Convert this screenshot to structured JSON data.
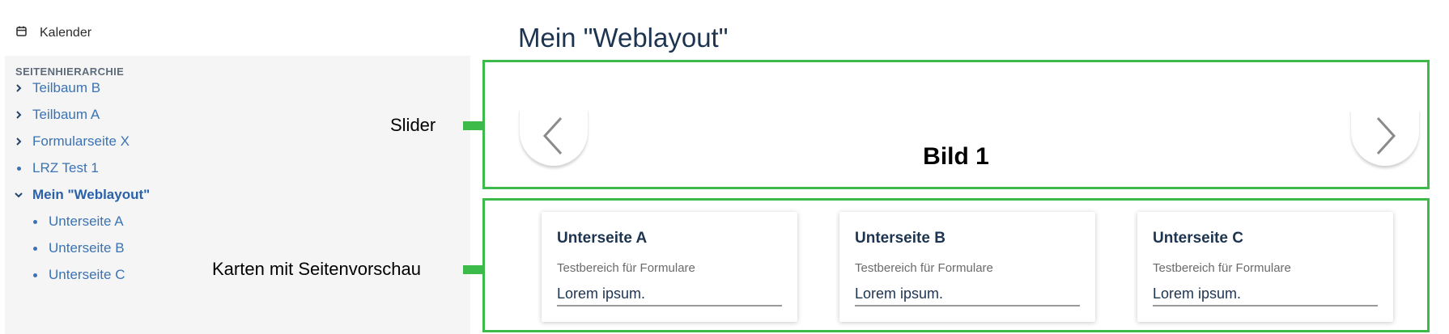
{
  "sidebar": {
    "calendar_label": "Kalender",
    "section_heading": "SEITENHIERARCHIE",
    "items": [
      {
        "label": "Teilbaum B"
      },
      {
        "label": "Teilbaum A"
      },
      {
        "label": "Formularseite X"
      },
      {
        "label": "LRZ Test 1"
      },
      {
        "label": "Mein \"Weblayout\""
      },
      {
        "label": "Unterseite A"
      },
      {
        "label": "Unterseite B"
      },
      {
        "label": "Unterseite C"
      }
    ]
  },
  "annotations": {
    "slider": "Slider",
    "cards": "Karten mit Seitenvorschau",
    "color": "#3dbb4a"
  },
  "main": {
    "title": "Mein \"Weblayout\"",
    "slider": {
      "slide_title": "Bild 1"
    },
    "cards": [
      {
        "title": "Unterseite A",
        "description": "Testbereich für Formulare",
        "value": "Lorem ipsum."
      },
      {
        "title": "Unterseite B",
        "description": "Testbereich für Formulare",
        "value": "Lorem ipsum."
      },
      {
        "title": "Unterseite C",
        "description": "Testbereich für Formulare",
        "value": "Lorem ipsum."
      }
    ]
  }
}
